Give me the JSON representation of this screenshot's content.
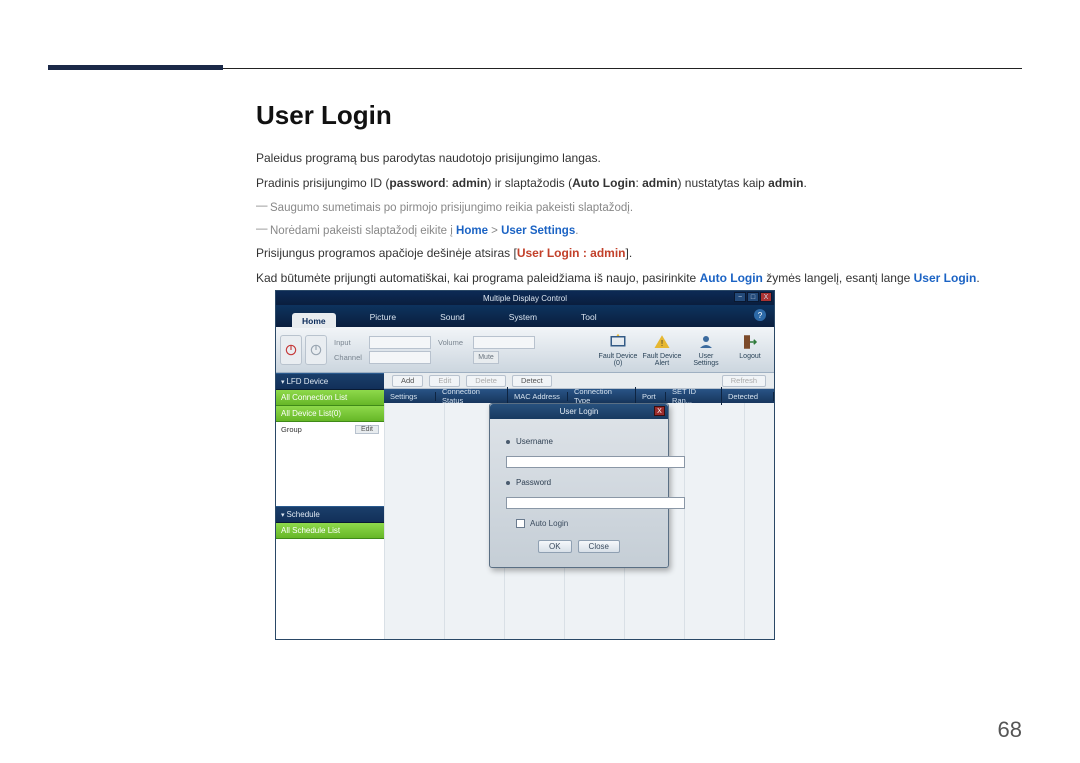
{
  "doc": {
    "heading": "User Login",
    "para1": "Paleidus programą bus parodytas naudotojo prisijungimo langas.",
    "para2_a": "Pradinis prisijungimo ID (",
    "para2_password": "password",
    "para2_b": ": ",
    "para2_admin1": "admin",
    "para2_c": ") ir slaptažodis (",
    "para2_auto": "Auto Login",
    "para2_d": ": ",
    "para2_admin2": "admin",
    "para2_e": ") nustatytas kaip ",
    "para2_admin3": "admin",
    "para2_f": ".",
    "note1": "Saugumo sumetimais po pirmojo prisijungimo reikia pakeisti slaptažodį.",
    "note2_a": "Norėdami pakeisti slaptažodį eikite į ",
    "note2_home": "Home",
    "note2_sep": " > ",
    "note2_user": "User Settings",
    "note2_b": ".",
    "para3_a": "Prisijungus programos apačioje dešinėje atsiras [",
    "para3_link": "User Login : admin",
    "para3_b": "].",
    "para4_a": "Kad būtumėte prijungti automatiškai, kai programa paleidžiama iš naujo, pasirinkite ",
    "para4_auto": "Auto Login",
    "para4_b": " žymės langelį, esantį lange ",
    "para4_user": "User Login",
    "para4_c": "."
  },
  "page": "68",
  "app": {
    "title": "Multiple Display Control",
    "menu": {
      "home": "Home",
      "picture": "Picture",
      "sound": "Sound",
      "system": "System",
      "tool": "Tool"
    },
    "toolbar": {
      "on": "On",
      "off": "Off",
      "input": "Input",
      "channel": "Channel",
      "volume": "Volume",
      "mute": "Mute",
      "fault_device": "Fault Device (0)",
      "fault_alert": "Fault Device Alert",
      "user_settings": "User Settings",
      "logout": "Logout"
    },
    "sidebar": {
      "lfd": "LFD Device",
      "all_conn": "All Connection List",
      "all_dev": "All Device List(0)",
      "group": "Group",
      "edit": "Edit",
      "schedule": "Schedule",
      "all_sched": "All Schedule List"
    },
    "main_buttons": {
      "add": "Add",
      "edit": "Edit",
      "delete": "Delete",
      "detect": "Detect",
      "refresh": "Refresh"
    },
    "cols": {
      "settings": "Settings",
      "conn": "Connection Status",
      "mac": "MAC Address",
      "ctype": "Connection Type",
      "port": "Port",
      "setid": "SET ID Ran...",
      "det": "Detected"
    },
    "login": {
      "title": "User Login",
      "username": "Username",
      "password": "Password",
      "auto": "Auto Login",
      "ok": "OK",
      "close": "Close"
    }
  }
}
